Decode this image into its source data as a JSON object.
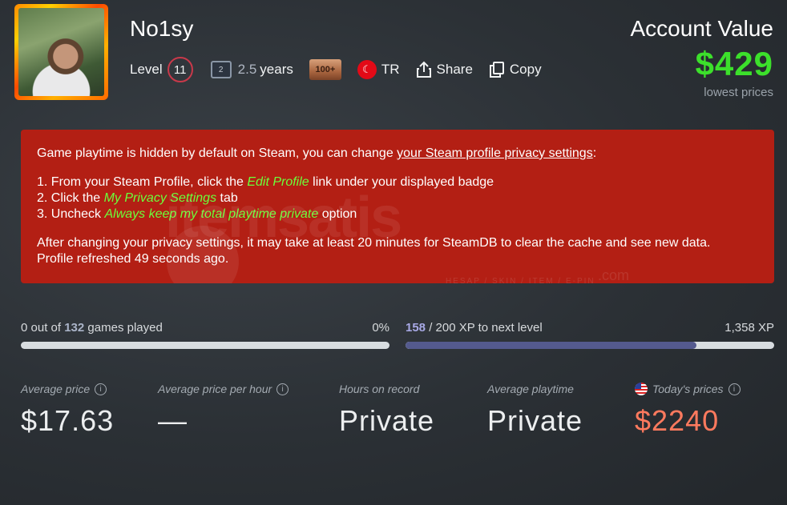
{
  "profile": {
    "name": "No1sy",
    "level_label": "Level",
    "level": "11",
    "years_badge": "2",
    "years_num": "2.5",
    "years_label": "years",
    "badge_text": "100+",
    "country": "TR",
    "share_label": "Share",
    "copy_label": "Copy"
  },
  "account": {
    "title": "Account Value",
    "value": "$429",
    "subtitle": "lowest prices"
  },
  "alert": {
    "intro": "Game playtime is hidden by default on Steam, you can change ",
    "link": "your Steam profile privacy settings",
    "intro_end": ":",
    "step1_pre": "1. From your Steam Profile, click the ",
    "step1_hl": "Edit Profile",
    "step1_post": " link under your displayed badge",
    "step2_pre": "2. Click the ",
    "step2_hl": "My Privacy Settings",
    "step2_post": " tab",
    "step3_pre": "3. Uncheck ",
    "step3_hl": "Always keep my total playtime private",
    "step3_post": " option",
    "outro": "After changing your privacy settings, it may take at least 20 minutes for SteamDB to clear the cache and see new data.",
    "refreshed": "Profile refreshed 49 seconds ago.",
    "watermark": "itemsatis",
    "watermark_sub": "HESAP / SKIN / ITEM / E-PIN",
    "watermark_dot": ".com"
  },
  "games": {
    "played": "0",
    "of_label": " out of ",
    "total": "132",
    "suffix": " games played",
    "percent": "0%",
    "fill_fraction": 0.0
  },
  "xp": {
    "current": "158",
    "suffix": " / 200 XP to next level",
    "total": "1,358 XP",
    "fill_fraction": 0.79
  },
  "stats": [
    {
      "label": "Average price",
      "value": "$17.63"
    },
    {
      "label": "Average price per hour",
      "value": "—"
    },
    {
      "label": "Hours on record",
      "value": "Private"
    },
    {
      "label": "Average playtime",
      "value": "Private"
    },
    {
      "label": "Today's prices",
      "value": "$2240"
    }
  ],
  "colors": {
    "accent_green": "#3ce02b",
    "alert_red": "#b31f14",
    "price_red": "#ff7a5e"
  }
}
